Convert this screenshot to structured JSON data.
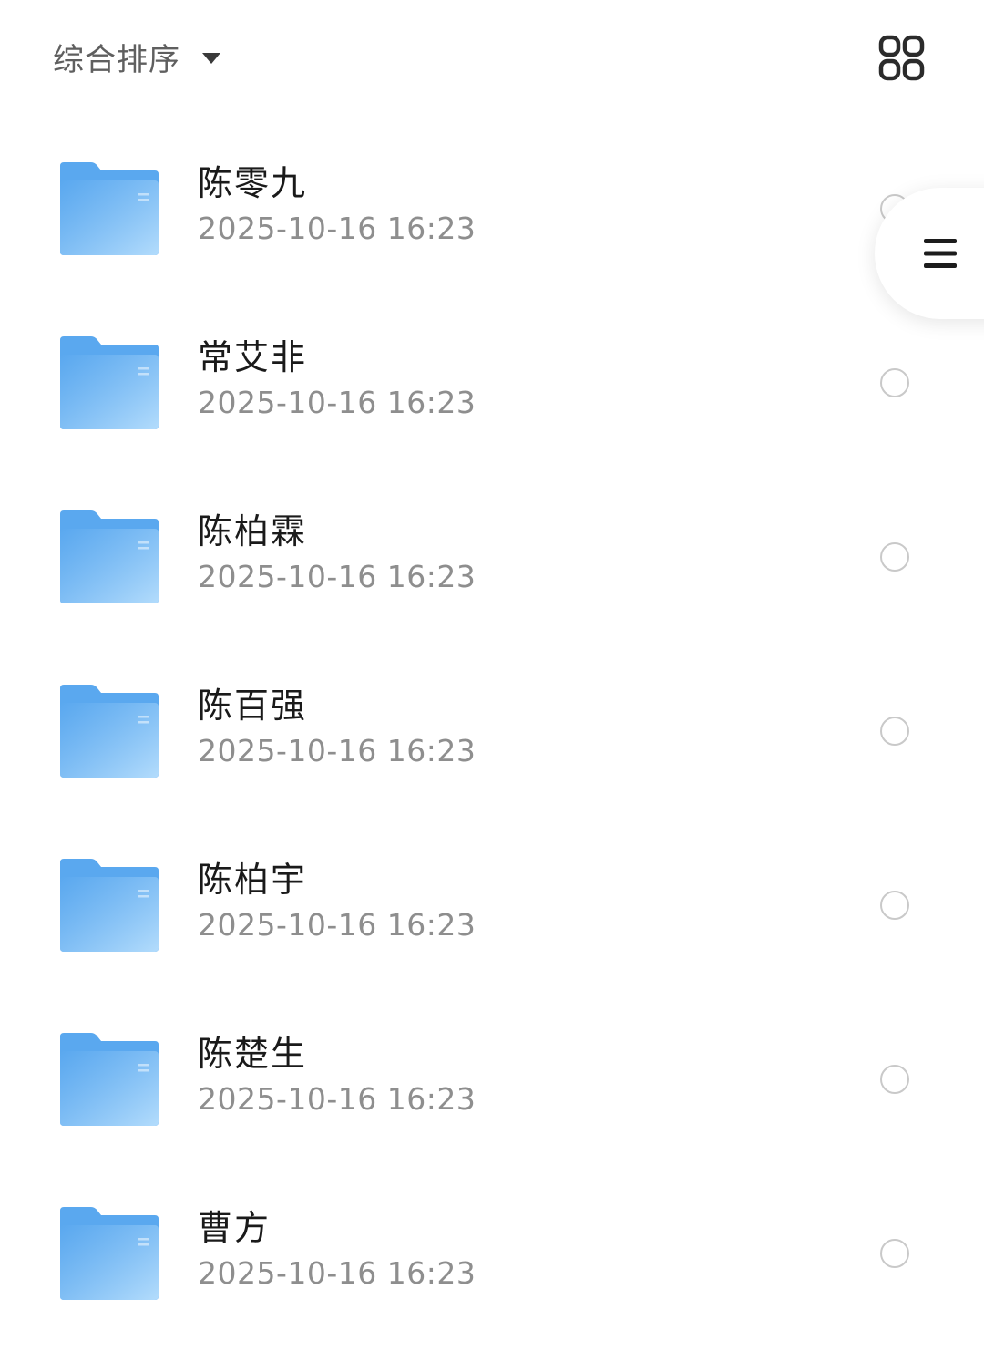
{
  "toolbar": {
    "sort_label": "综合排序",
    "sort_icon": "caret-down-icon",
    "view_toggle_icon": "grid-view-icon"
  },
  "colors": {
    "folder_light": "#b3dcfc",
    "folder_dark": "#5aa8ef",
    "name_text": "#1a1a1a",
    "date_text": "#8e8e8e",
    "radio_border": "#c9c9c9"
  },
  "files": [
    {
      "name": "陈零九",
      "date": "2025-10-16 16:23",
      "type": "folder"
    },
    {
      "name": "常艾非",
      "date": "2025-10-16 16:23",
      "type": "folder"
    },
    {
      "name": "陈柏霖",
      "date": "2025-10-16 16:23",
      "type": "folder"
    },
    {
      "name": "陈百强",
      "date": "2025-10-16 16:23",
      "type": "folder"
    },
    {
      "name": "陈柏宇",
      "date": "2025-10-16 16:23",
      "type": "folder"
    },
    {
      "name": "陈楚生",
      "date": "2025-10-16 16:23",
      "type": "folder"
    },
    {
      "name": "曹方",
      "date": "2025-10-16 16:23",
      "type": "folder"
    }
  ],
  "floating_button": {
    "icon": "menu-icon"
  }
}
